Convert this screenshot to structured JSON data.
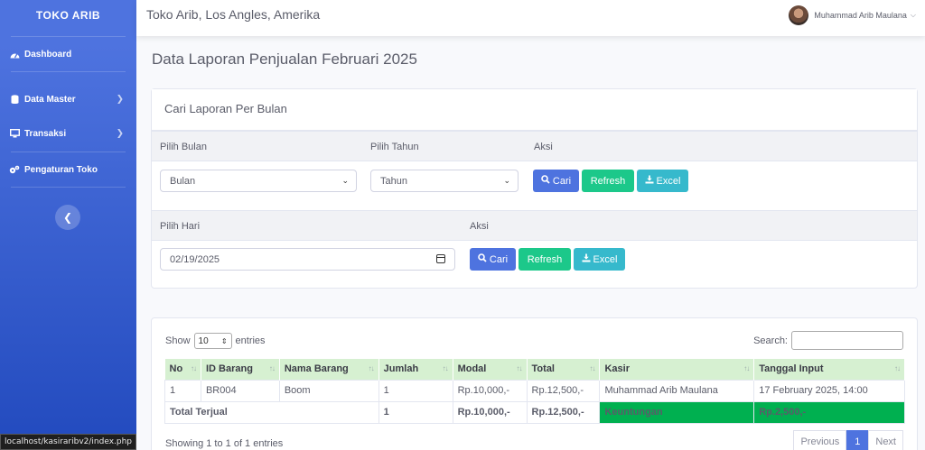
{
  "sidebar": {
    "brand": "TOKO ARIB",
    "items": [
      {
        "label": "Dashboard"
      },
      {
        "label": "Data Master"
      },
      {
        "label": "Transaksi"
      },
      {
        "label": "Pengaturan Toko"
      }
    ]
  },
  "status_url": "localhost/kasiraribv2/index.php",
  "topbar": {
    "title": "Toko Arib, Los Angles, Amerika",
    "user": "Muhammad Arib Maulana"
  },
  "page_title": "Data Laporan Penjualan Februari 2025",
  "filter_card": {
    "header": "Cari Laporan Per Bulan",
    "month_label": "Pilih Bulan",
    "year_label": "Pilih Tahun",
    "action_label": "Aksi",
    "month_value": "Bulan",
    "year_value": "Tahun",
    "day_label": "Pilih Hari",
    "action_label2": "Aksi",
    "date_value": "02/19/2025",
    "btn_search": "Cari",
    "btn_refresh": "Refresh",
    "btn_excel": "Excel"
  },
  "table_card": {
    "show": "Show",
    "entries_value": "10",
    "entries": "entries",
    "search": "Search:",
    "columns": [
      "No",
      "ID Barang",
      "Nama Barang",
      "Jumlah",
      "Modal",
      "Total",
      "Kasir",
      "Tanggal Input"
    ],
    "rows": [
      [
        "1",
        "BR004",
        "Boom",
        "1",
        "Rp.10,000,-",
        "Rp.12,500,-",
        "Muhammad Arib Maulana",
        "17 February 2025, 14:00"
      ]
    ],
    "total_row": {
      "label": "Total Terjual",
      "jumlah": "1",
      "modal": "Rp.10,000,-",
      "total": "Rp.12,500,-",
      "keuntungan_label": "Keuntungan",
      "keuntungan_value": "Rp.2,500,-"
    },
    "info": "Showing 1 to 1 of 1 entries",
    "pager": {
      "prev": "Previous",
      "page": "1",
      "next": "Next"
    }
  },
  "colors": {
    "primary": "#4e73df",
    "success": "#1cc88a",
    "info": "#36b9cc",
    "profit": "#00b050",
    "header_green": "#d6f0d1"
  }
}
